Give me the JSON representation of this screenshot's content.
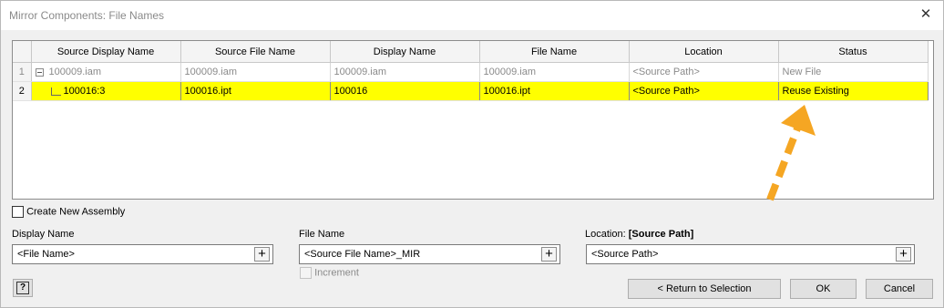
{
  "window": {
    "title": "Mirror Components: File Names",
    "close_glyph": "✕"
  },
  "grid": {
    "columns": [
      "",
      "Source Display Name",
      "Source File Name",
      "Display Name",
      "File Name",
      "Location",
      "Status"
    ],
    "rows": [
      {
        "num": "1",
        "source_display_name": "100009.iam",
        "source_file_name": "100009.iam",
        "display_name": "100009.iam",
        "file_name": "100009.iam",
        "location": "<Source Path>",
        "status": "New File"
      },
      {
        "num": "2",
        "source_display_name": "100016:3",
        "source_file_name": "100016.ipt",
        "display_name": "100016",
        "file_name": "100016.ipt",
        "location": "<Source Path>",
        "status": "Reuse Existing"
      }
    ],
    "highlight_color": "#ffff00"
  },
  "options": {
    "create_new_assembly": "Create New Assembly",
    "increment": "Increment"
  },
  "fields": {
    "display_name": {
      "label": "Display Name",
      "value": "<File Name>"
    },
    "file_name": {
      "label": "File Name",
      "value": "<Source File Name>_MIR"
    },
    "location": {
      "label": "Location:",
      "label_value": "[Source Path]",
      "value": "<Source Path>"
    },
    "plus_glyph": "+"
  },
  "buttons": {
    "return_to_selection": "< Return to Selection",
    "ok": "OK",
    "cancel": "Cancel",
    "help_glyph": "?"
  },
  "annotation": {
    "arrow_color": "#f5a623"
  }
}
